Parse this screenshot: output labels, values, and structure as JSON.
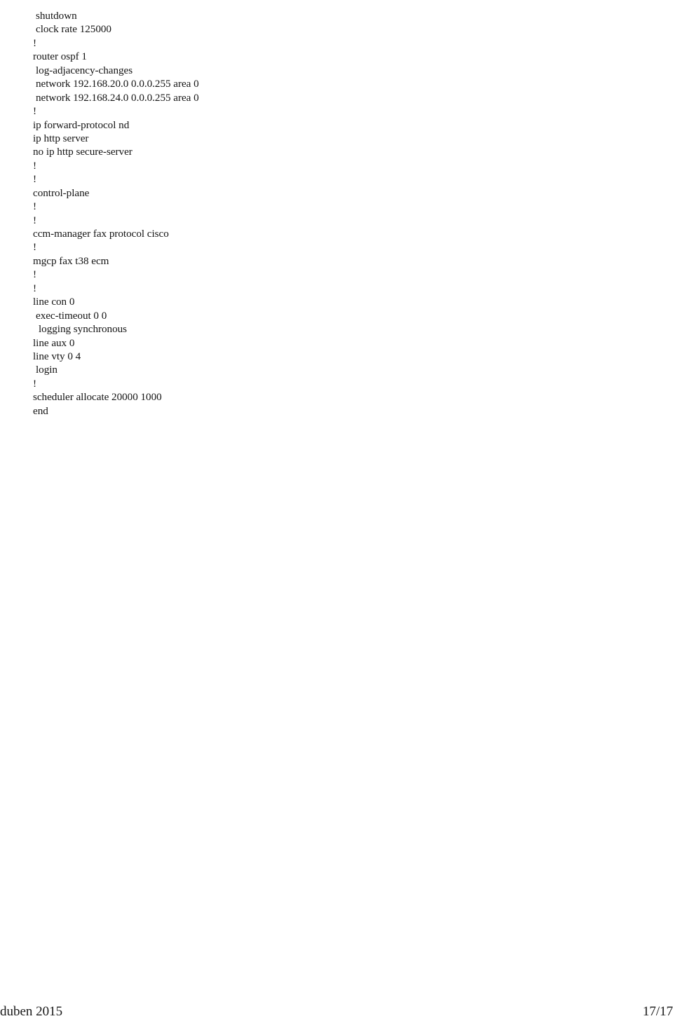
{
  "document": {
    "background_color": "#ffffff",
    "text_color": "#141414"
  },
  "config_listing": {
    "name": "running-configuration-excerpt",
    "lines": [
      {
        "text": "shutdown",
        "indent": 1,
        "delim": false
      },
      {
        "text": "clock rate 125000",
        "indent": 1,
        "delim": false
      },
      {
        "text": "!",
        "indent": 0,
        "delim": true
      },
      {
        "text": "router ospf 1",
        "indent": 0,
        "delim": false
      },
      {
        "text": "log-adjacency-changes",
        "indent": 1,
        "delim": false
      },
      {
        "text": "network 192.168.20.0 0.0.0.255 area 0",
        "indent": 1,
        "delim": false
      },
      {
        "text": "network 192.168.24.0 0.0.0.255 area 0",
        "indent": 1,
        "delim": false
      },
      {
        "text": "!",
        "indent": 0,
        "delim": true
      },
      {
        "text": "ip forward-protocol nd",
        "indent": 0,
        "delim": false
      },
      {
        "text": "ip http server",
        "indent": 0,
        "delim": false
      },
      {
        "text": "no ip http secure-server",
        "indent": 0,
        "delim": false
      },
      {
        "text": "!",
        "indent": 0,
        "delim": true
      },
      {
        "text": "!",
        "indent": 0,
        "delim": true
      },
      {
        "text": "control-plane",
        "indent": 0,
        "delim": false
      },
      {
        "text": "!",
        "indent": 0,
        "delim": true
      },
      {
        "text": "!",
        "indent": 0,
        "delim": true
      },
      {
        "text": "ccm-manager fax protocol cisco",
        "indent": 0,
        "delim": false
      },
      {
        "text": "!",
        "indent": 0,
        "delim": true
      },
      {
        "text": "mgcp fax t38 ecm",
        "indent": 0,
        "delim": false
      },
      {
        "text": "!",
        "indent": 0,
        "delim": true
      },
      {
        "text": "!",
        "indent": 0,
        "delim": true
      },
      {
        "text": "line con 0",
        "indent": 0,
        "delim": false
      },
      {
        "text": "exec-timeout 0 0",
        "indent": 1,
        "delim": false
      },
      {
        "text": "logging synchronous",
        "indent": 2,
        "delim": false
      },
      {
        "text": "line aux 0",
        "indent": 0,
        "delim": false
      },
      {
        "text": "line vty 0 4",
        "indent": 0,
        "delim": false
      },
      {
        "text": "login",
        "indent": 1,
        "delim": false
      },
      {
        "text": "!",
        "indent": 0,
        "delim": true
      },
      {
        "text": "scheduler allocate 20000 1000",
        "indent": 0,
        "delim": false
      },
      {
        "text": "end",
        "indent": 0,
        "delim": false
      }
    ]
  },
  "footer": {
    "left_text": "duben 2015",
    "right_text": "17/17",
    "page_number": 17,
    "page_total": 17
  }
}
